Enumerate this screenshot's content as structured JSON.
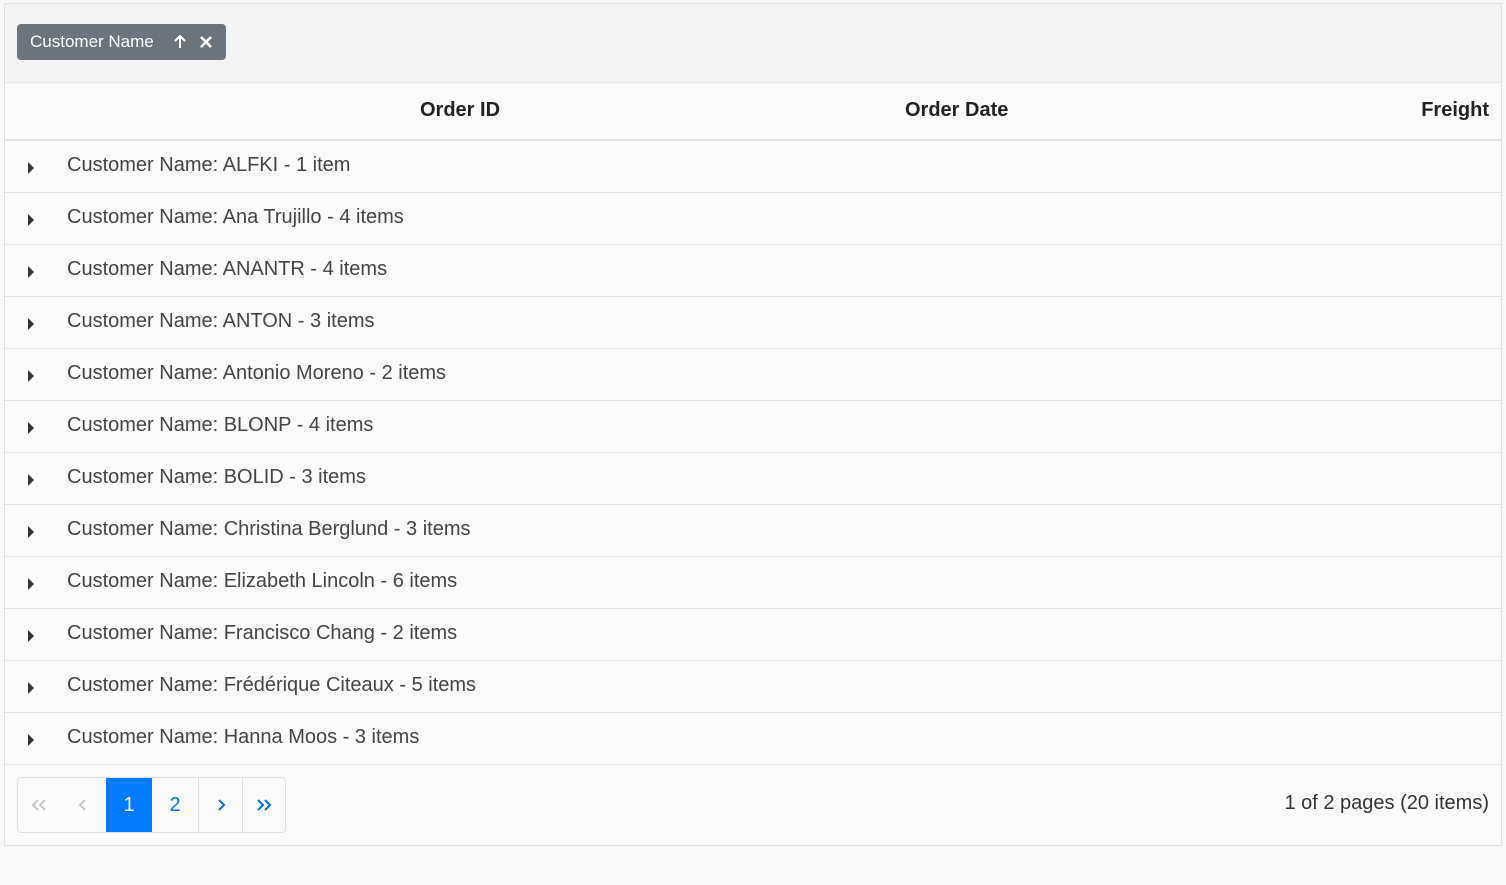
{
  "group_panel": {
    "chip_label": "Customer Name",
    "sort_icon": "arrow-up-icon",
    "remove_icon": "close-icon"
  },
  "columns": {
    "order_id": "Order ID",
    "order_date": "Order Date",
    "freight": "Freight"
  },
  "groups": [
    {
      "label": "Customer Name: ALFKI - 1 item"
    },
    {
      "label": "Customer Name: Ana Trujillo - 4 items"
    },
    {
      "label": "Customer Name: ANANTR - 4 items"
    },
    {
      "label": "Customer Name: ANTON - 3 items"
    },
    {
      "label": "Customer Name: Antonio Moreno - 2 items"
    },
    {
      "label": "Customer Name: BLONP - 4 items"
    },
    {
      "label": "Customer Name: BOLID - 3 items"
    },
    {
      "label": "Customer Name: Christina Berglund - 3 items"
    },
    {
      "label": "Customer Name: Elizabeth Lincoln - 6 items"
    },
    {
      "label": "Customer Name: Francisco Chang - 2 items"
    },
    {
      "label": "Customer Name: Frédérique Citeaux - 5 items"
    },
    {
      "label": "Customer Name: Hanna Moos - 3 items"
    }
  ],
  "pager": {
    "pages": [
      "1",
      "2"
    ],
    "current_page": "1",
    "info": "1 of 2 pages (20 items)"
  },
  "colors": {
    "active_page": "#007bff",
    "link": "#0a6fd8",
    "chip_bg": "#6c757d"
  }
}
